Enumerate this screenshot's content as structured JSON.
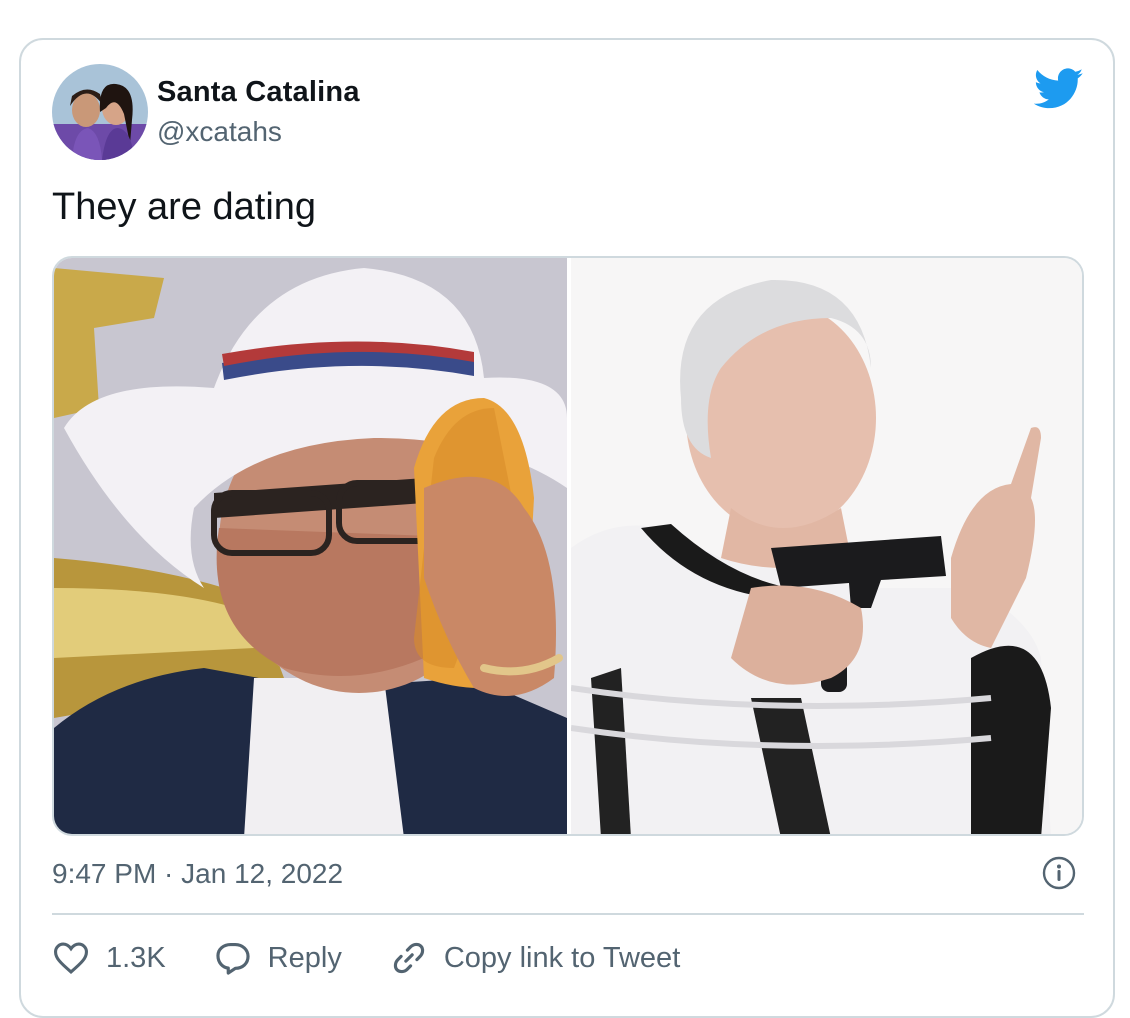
{
  "tweet": {
    "display_name": "Santa Catalina",
    "handle": "@xcatahs",
    "text": "They are dating",
    "timestamp": "9:47 PM · Jan 12, 2022",
    "media_count": 2
  },
  "actions": {
    "like_count": "1.3K",
    "reply_label": "Reply",
    "copy_label": "Copy link to Tweet"
  },
  "icons": {
    "brand": "twitter-bird-icon",
    "info": "info-icon",
    "like": "heart-icon",
    "reply": "speech-bubble-icon",
    "copy": "link-icon"
  },
  "colors": {
    "brand_blue": "#1d9bf0",
    "text_primary": "#0f1419",
    "text_secondary": "#536471",
    "border": "#cfd9de"
  }
}
